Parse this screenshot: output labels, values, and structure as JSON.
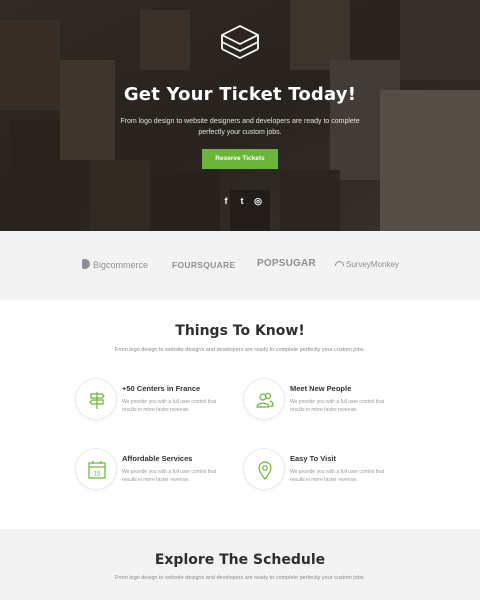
{
  "hero": {
    "title": "Get Your Ticket Today!",
    "text": "From logo design to website designers and developers are ready to complete perfectly your custom jobs.",
    "button_label": "Reserve Tickets",
    "accent": "#6ab53a",
    "social": [
      {
        "icon": "facebook-icon",
        "glyph": "f"
      },
      {
        "icon": "twitter-icon",
        "glyph": "t"
      },
      {
        "icon": "instagram-icon",
        "glyph": "◎"
      }
    ]
  },
  "brands": {
    "items": [
      "Bigcommerce",
      "FOURSQUARE",
      "POPSUGAR",
      "SurveyMonkey"
    ]
  },
  "things": {
    "title": "Things To Know!",
    "subtitle": "From logo design to website designs and developers are ready to complete perfectly your custom jobs.",
    "features": [
      {
        "title": "+50 Centers in France",
        "desc": "We provide you with a full user control that results in more faster revenue.",
        "icon": "signpost-icon"
      },
      {
        "title": "Meet New People",
        "desc": "We provide you with a full user control that results in more faster revenue.",
        "icon": "people-icon"
      },
      {
        "title": "Affordable Services",
        "desc": "We provide you with a full user control that results in more faster revenue.",
        "icon": "calendar-icon",
        "calendar_day": "15"
      },
      {
        "title": "Easy To Visit",
        "desc": "We provide you with a full user control that results in more faster revenue.",
        "icon": "map-pin-icon"
      }
    ]
  },
  "schedule": {
    "title": "Explore The Schedule",
    "subtitle": "From logo design to website designs and developers are ready to complete perfectly your custom jobs."
  }
}
